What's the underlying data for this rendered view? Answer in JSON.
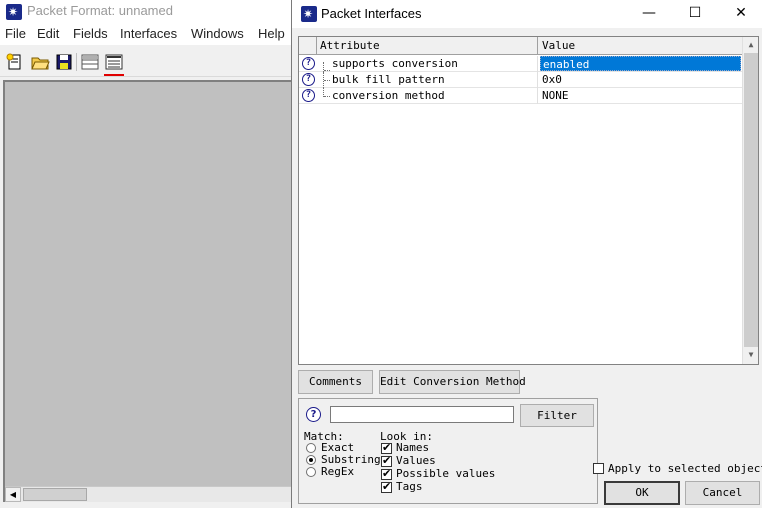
{
  "background_window": {
    "title": "Packet Format: unnamed",
    "menu": [
      "File",
      "Edit",
      "Fields",
      "Interfaces",
      "Windows",
      "Help"
    ],
    "toolbar_icons": [
      "new-file-icon",
      "open-folder-icon",
      "save-icon",
      "grid-view-icon",
      "packet-view-icon"
    ]
  },
  "dialog": {
    "title": "Packet Interfaces",
    "window_controls": {
      "minimize": "—",
      "maximize": "☐",
      "close": "✕"
    },
    "table": {
      "columns": [
        "Attribute",
        "Value"
      ],
      "rows": [
        {
          "attribute": "supports conversion",
          "value": "enabled",
          "selected": true
        },
        {
          "attribute": "bulk fill pattern",
          "value": "0x0",
          "selected": false
        },
        {
          "attribute": "conversion method",
          "value": "NONE",
          "selected": false
        }
      ]
    },
    "buttons": {
      "comments": "Comments",
      "edit_conversion": "Edit Conversion Method",
      "filter": "Filter",
      "ok": "OK",
      "cancel": "Cancel"
    },
    "filter": {
      "input_value": "",
      "match_label": "Match:",
      "match_options": [
        "Exact",
        "Substring",
        "RegEx"
      ],
      "match_selected": "Substring",
      "look_in_label": "Look in:",
      "look_in_options": [
        "Names",
        "Values",
        "Possible values",
        "Tags"
      ],
      "look_in_checked": [
        true,
        true,
        true,
        true
      ]
    },
    "apply_to_selected": {
      "label": "Apply to selected objects",
      "checked": false
    }
  }
}
